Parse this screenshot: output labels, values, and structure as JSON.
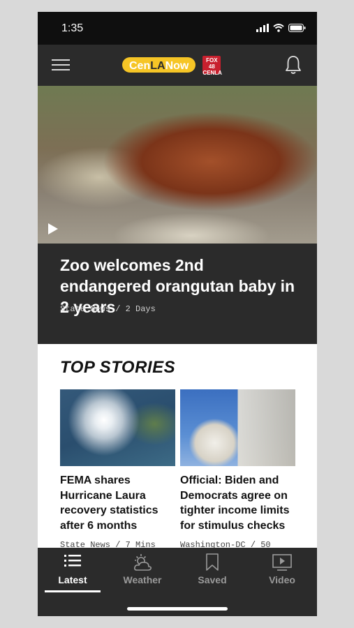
{
  "status_bar": {
    "time": "1:35"
  },
  "app_bar": {
    "logo_text_1": "Cen",
    "logo_text_2": "LA",
    "logo_text_3": "Now",
    "fox_badge": "FOX 48 CENLA"
  },
  "hero": {
    "title": "Zoo welcomes 2nd endangered orangutan baby in 2 years",
    "meta": "State News / 2 Days"
  },
  "top_stories": {
    "heading": "TOP STORIES",
    "items": [
      {
        "title": "FEMA shares Hurricane Laura recovery statistics after 6 months",
        "meta": "State News / 7 Mins"
      },
      {
        "title": "Official: Biden and Democrats agree on tighter income limits for stimulus checks",
        "meta": "Washington-DC / 50"
      }
    ]
  },
  "tabs": [
    {
      "label": "Latest",
      "icon": "list-icon",
      "active": true
    },
    {
      "label": "Weather",
      "icon": "weather-icon",
      "active": false
    },
    {
      "label": "Saved",
      "icon": "bookmark-icon",
      "active": false
    },
    {
      "label": "Video",
      "icon": "video-icon",
      "active": false
    }
  ],
  "colors": {
    "brand_yellow": "#f6c526",
    "fox_red": "#c8202e",
    "bar_dark": "#2b2b2b"
  }
}
